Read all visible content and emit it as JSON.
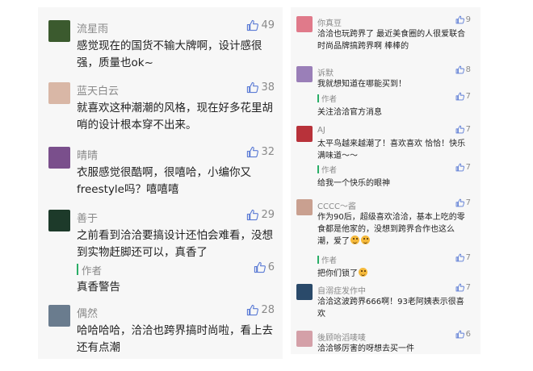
{
  "left_comments": [
    {
      "name": "流星雨",
      "likes": "49",
      "text": "感觉现在的国货不输大牌啊，设计感很强，质量也ok~",
      "avatar_color": "#3b5a2e"
    },
    {
      "name": "蓝天白云",
      "likes": "38",
      "text": "就喜欢这种潮潮的风格，现在好多花里胡哨的设计根本穿不出来。",
      "avatar_color": "#d9b7a6"
    },
    {
      "name": "晴晴",
      "likes": "32",
      "text": "衣服感觉很酷啊，很嘻哈，小编你又freestyle吗？嘻嘻嘻",
      "avatar_color": "#7a4f8c"
    },
    {
      "name": "善于",
      "likes": "29",
      "text": "之前看到洽洽要搞设计还怕会难看，没想到实物赶脚还可以，真香了",
      "avatar_color": "#1d3a2a",
      "reply": {
        "author": "作者",
        "likes": "6",
        "text": "真香警告"
      }
    },
    {
      "name": "偶然",
      "likes": "28",
      "text": "哈哈哈哈，洽洽也跨界搞时尚啦，看上去还有点潮",
      "avatar_color": "#6a7c8e"
    }
  ],
  "right_comments": [
    {
      "name": "你真豆",
      "likes": "9",
      "text": "洽洽也玩跨界了 最近美食圈的人很爱联合时尚品牌搞跨界啊 棒棒的",
      "avatar_color": "#e07a8a"
    },
    {
      "name": "诉默",
      "likes": "8",
      "text": "我就想知道在哪能买到！",
      "avatar_color": "#9a7fb8",
      "reply": {
        "author": "作者",
        "likes": "7",
        "text": "关注洽洽官方消息"
      }
    },
    {
      "name": "AJ",
      "likes": "7",
      "text": "太平鸟越来越潮了！喜欢喜欢 恰恰！快乐满味道～～",
      "avatar_color": "#b8323a",
      "reply": {
        "author": "作者",
        "likes": "7",
        "text": "给我一个快乐的眼神"
      }
    },
    {
      "name": "CCCC～酱",
      "likes": "7",
      "text": "作为90后，超级喜欢洽洽，基本上吃的零食都是他家的，没想到跨界合作也这么潮，爱了",
      "avatar_color": "#c9a090",
      "reply": {
        "author": "作者",
        "likes": "7",
        "text": "把你们锁了"
      }
    },
    {
      "name": "自溺症发作中",
      "likes": "7",
      "text": "洽洽这波跨界666啊！93老阿姨表示很喜欢",
      "avatar_color": "#2a4a6a"
    },
    {
      "name": "後顾咍滔唛唛",
      "likes": "6",
      "text": "洽洽够厉害的呀想去买一件",
      "avatar_color": "#d4a0a8"
    }
  ],
  "icons": {
    "like": "thumbs-up-icon",
    "emoji": "grinning-emoji-icon"
  },
  "colors": {
    "name": "#8a8a8a",
    "author_bar": "#2aae67",
    "thumb": "#5b7bd5"
  }
}
